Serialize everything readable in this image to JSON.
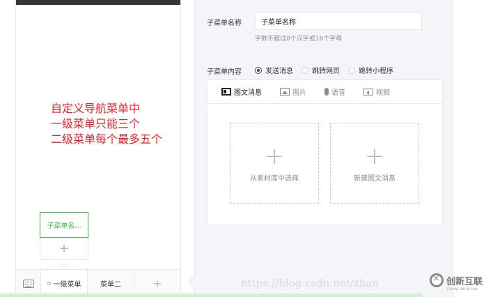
{
  "annotation": {
    "lines": [
      "自定义导航菜单中",
      "一级菜单只能三个",
      "二级菜单每个最多五个"
    ],
    "color": "#e0242b"
  },
  "preview": {
    "sub_menu_item": "子菜单名...",
    "add_sub_menu": "+",
    "menubar": {
      "keyboard_icon": "keyboard-icon",
      "menu1": "一级菜单",
      "menu2": "菜单二",
      "add_menu": "+"
    }
  },
  "form": {
    "name_label": "子菜单名称",
    "name_value": "子菜单名称",
    "name_hint": "字数不超过8个汉字或16个字母",
    "content_label": "子菜单内容",
    "radio_options": [
      {
        "label": "发送消息",
        "checked": true
      },
      {
        "label": "跳转网页",
        "checked": false
      },
      {
        "label": "跳转小程序",
        "checked": false
      }
    ],
    "tabs": [
      {
        "label": "图文消息",
        "icon": "news-icon"
      },
      {
        "label": "图片",
        "icon": "image-icon"
      },
      {
        "label": "语音",
        "icon": "voice-icon"
      },
      {
        "label": "视频",
        "icon": "video-icon"
      }
    ],
    "cards": [
      {
        "plus": "+",
        "label": "从素材库中选择"
      },
      {
        "plus": "+",
        "label": "新建图文消息"
      }
    ]
  },
  "watermark": {
    "url": "https://blog.csdn.net/zhan",
    "logo_text": "创新互联",
    "logo_sub": "CHUANG XIN HU LIAN"
  },
  "colors": {
    "accent_green": "#44b549",
    "panel_bg": "#f4f5f9",
    "border": "#e7e7eb"
  }
}
